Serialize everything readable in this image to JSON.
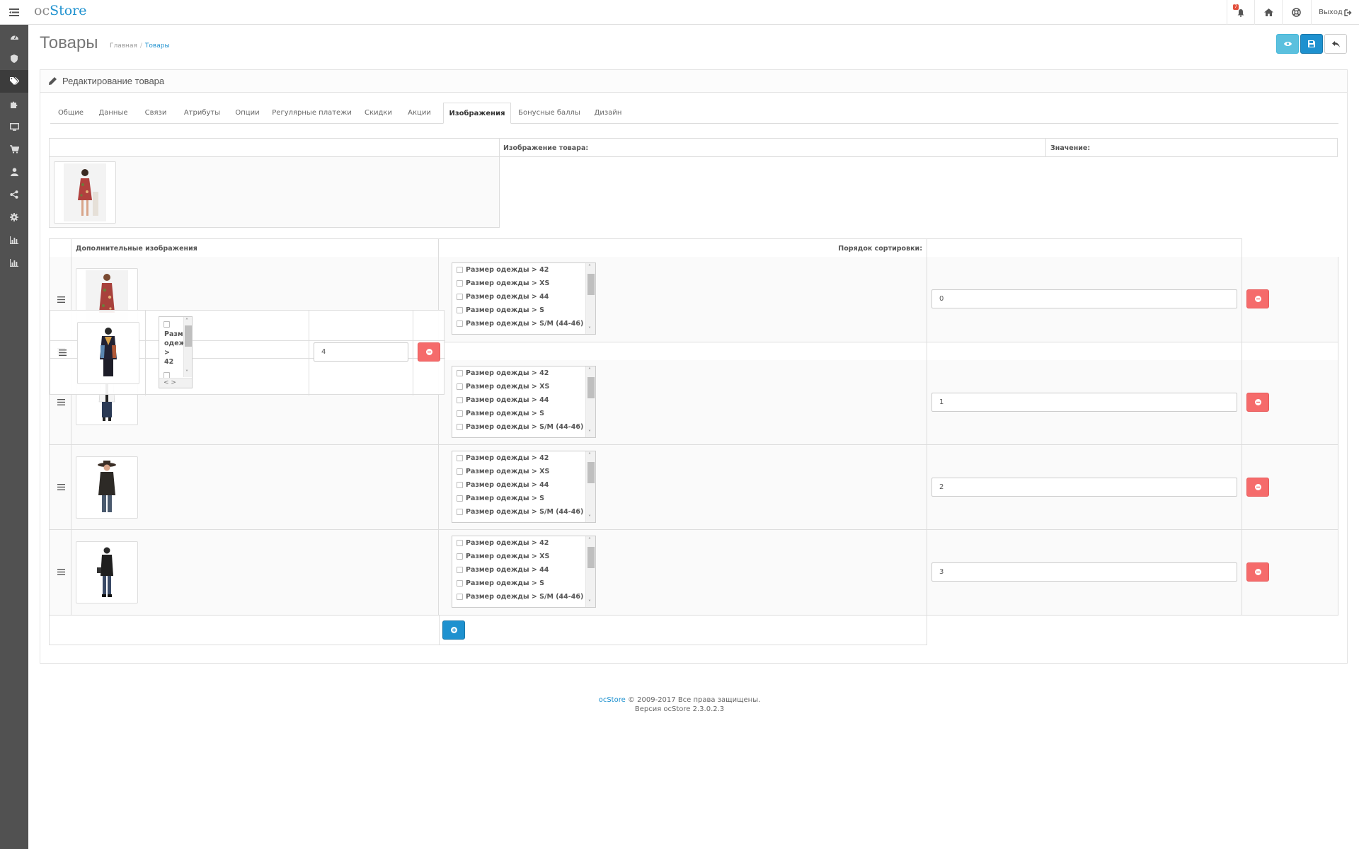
{
  "header": {
    "logo_oc": "oc",
    "logo_store": "Store",
    "notifications_count": "7",
    "logout_label": "Выход"
  },
  "page": {
    "title": "Товары",
    "breadcrumb": [
      "Главная",
      "Товары"
    ]
  },
  "panel": {
    "title": "Редактирование товара"
  },
  "tabs": [
    "Общие",
    "Данные",
    "Связи",
    "Атрибуты",
    "Опции",
    "Регулярные платежи",
    "Скидки",
    "Акции",
    "Изображения",
    "Бонусные баллы",
    "Дизайн"
  ],
  "active_tab": "Изображения",
  "main_image_table": {
    "col_image": "Изображение товара:",
    "col_value": "Значение:"
  },
  "additional_table": {
    "col_images": "Дополнительные изображения",
    "col_sort": "Порядок сортировки:"
  },
  "option_labels": [
    "Размер одежды > 42",
    "Размер одежды > XS",
    "Размер одежды > 44",
    "Размер одежды > S",
    "Размер одежды > S/M (44-46)"
  ],
  "rows": [
    {
      "sort": "0"
    },
    {
      "sort": "1"
    },
    {
      "sort": "2"
    },
    {
      "sort": "3"
    }
  ],
  "dragged_row": {
    "sort": "4",
    "option_fragment": [
      "Разм",
      "одеж",
      ">",
      "42"
    ]
  },
  "footer": {
    "brand": "ocStore",
    "copyright": "© 2009-2017 Все права защищены.",
    "version": "Версия ocStore 2.3.0.2.3"
  },
  "colors": {
    "sidebar": "#515151",
    "accent_blue": "#1e91cf",
    "light_blue": "#5bc0de",
    "danger": "#f56b6b"
  }
}
